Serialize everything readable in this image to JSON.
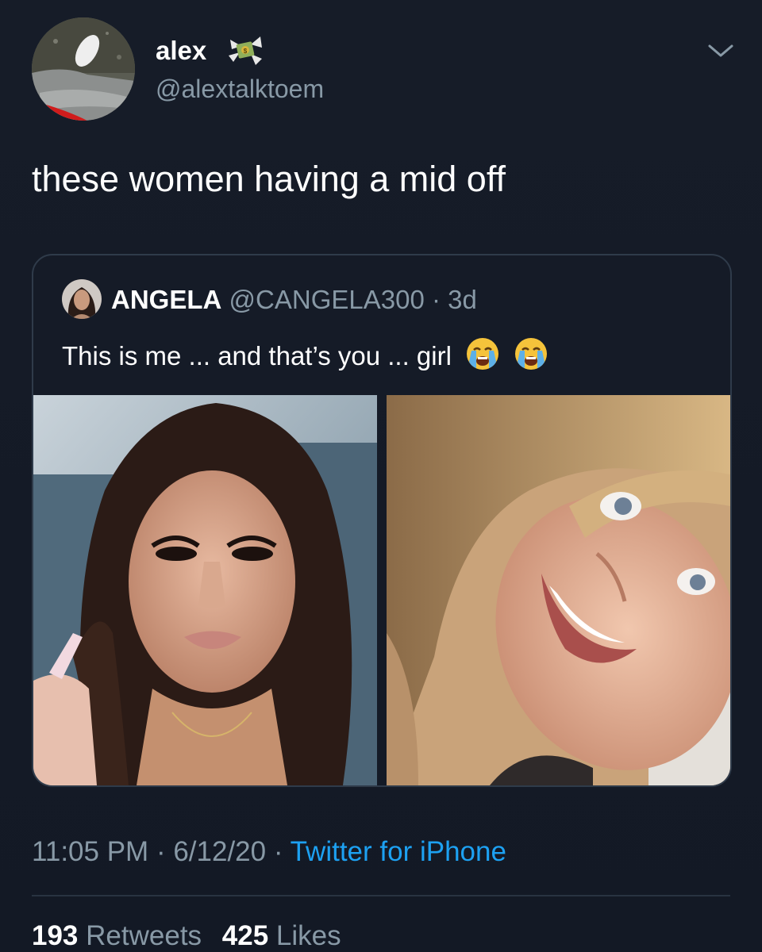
{
  "tweet": {
    "display_name": "alex",
    "name_emoji_icon": "money-wings-icon",
    "handle": "@alextalktoem",
    "text": "these women having a mid off",
    "more_icon": "chevron-down-icon"
  },
  "quote": {
    "name": "ANGELA",
    "handle": "@CANGELA300",
    "separator": " · ",
    "age": "3d",
    "text": "This is me ... and that’s you ... girl",
    "emoji_icon": "loudly-crying-face-icon"
  },
  "meta": {
    "time": "11:05 PM",
    "separator": " · ",
    "date": "6/12/20",
    "source": "Twitter for iPhone"
  },
  "stats": {
    "retweets_count": "193",
    "retweets_label": "Retweets",
    "likes_count": "425",
    "likes_label": "Likes"
  },
  "colors": {
    "background": "#151b26",
    "secondary_text": "#8899a6",
    "link": "#1da1f2",
    "border": "#2f3b4a"
  }
}
